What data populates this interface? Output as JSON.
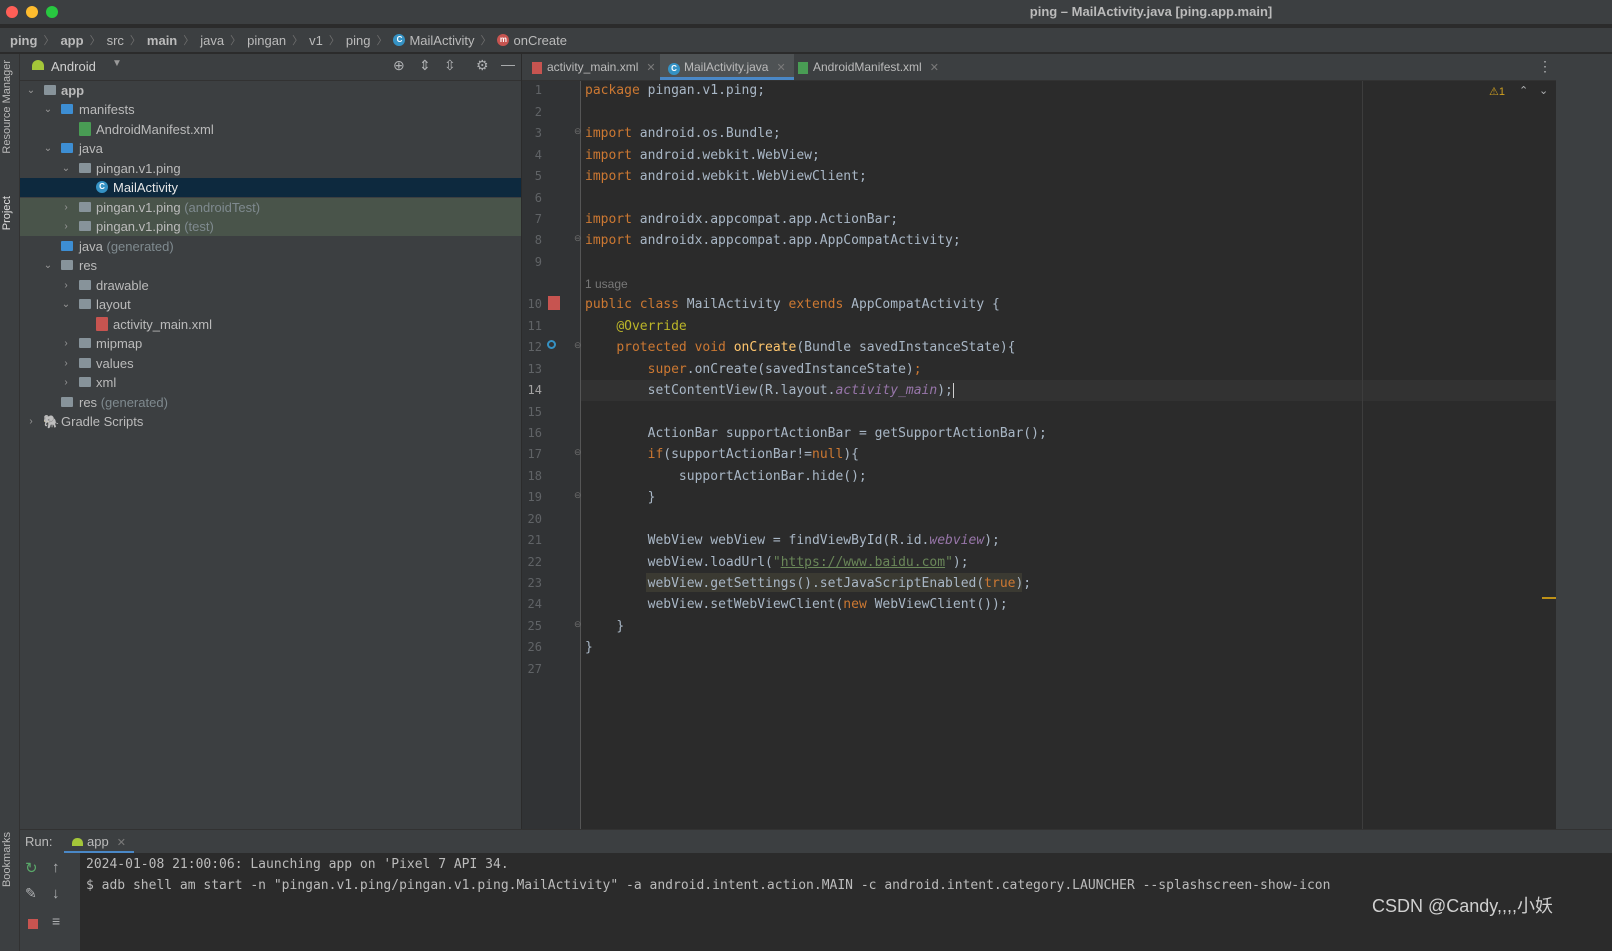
{
  "window": {
    "title": "ping – MailActivity.java [ping.app.main]"
  },
  "breadcrumb": {
    "items": [
      "ping",
      "app",
      "src",
      "main",
      "java",
      "pingan",
      "v1",
      "ping",
      "MailActivity",
      "onCreate"
    ]
  },
  "left_stripe": {
    "resource_manager": "Resource Manager",
    "project": "Project",
    "bookmarks": "Bookmarks"
  },
  "project_panel": {
    "view_selector": "Android",
    "tree": [
      {
        "label": "app",
        "suffix": ""
      },
      {
        "label": "manifests",
        "suffix": ""
      },
      {
        "label": "AndroidManifest.xml",
        "suffix": ""
      },
      {
        "label": "java",
        "suffix": ""
      },
      {
        "label": "pingan.v1.ping",
        "suffix": ""
      },
      {
        "label": "MailActivity",
        "suffix": ""
      },
      {
        "label": "pingan.v1.ping",
        "suffix": "(androidTest)"
      },
      {
        "label": "pingan.v1.ping",
        "suffix": "(test)"
      },
      {
        "label": "java",
        "suffix": "(generated)"
      },
      {
        "label": "res",
        "suffix": ""
      },
      {
        "label": "drawable",
        "suffix": ""
      },
      {
        "label": "layout",
        "suffix": ""
      },
      {
        "label": "activity_main.xml",
        "suffix": ""
      },
      {
        "label": "mipmap",
        "suffix": ""
      },
      {
        "label": "values",
        "suffix": ""
      },
      {
        "label": "xml",
        "suffix": ""
      },
      {
        "label": "res",
        "suffix": "(generated)"
      },
      {
        "label": "Gradle Scripts",
        "suffix": ""
      }
    ]
  },
  "editor": {
    "tabs": [
      "activity_main.xml",
      "MailActivity.java",
      "AndroidManifest.xml"
    ],
    "active_tab": "MailActivity.java",
    "warning_count": "1",
    "usage_hint": "1 usage",
    "line_numbers": [
      "1",
      "2",
      "3",
      "4",
      "5",
      "6",
      "7",
      "8",
      "9",
      "10",
      "11",
      "12",
      "13",
      "14",
      "15",
      "16",
      "17",
      "18",
      "19",
      "20",
      "21",
      "22",
      "23",
      "24",
      "25",
      "26",
      "27"
    ],
    "code": {
      "l1_kw": "package",
      "l1_rest": " pingan.v1.ping;",
      "l3_kw": "import",
      "l3_rest": " android.os.Bundle;",
      "l4_kw": "import",
      "l4_rest": " android.webkit.WebView;",
      "l5_kw": "import",
      "l5_rest": " android.webkit.WebViewClient;",
      "l7_kw": "import",
      "l7_rest": " androidx.appcompat.app.ActionBar;",
      "l8_kw": "import",
      "l8_rest": " androidx.appcompat.app.AppCompatActivity;",
      "l10_kw1": "public class",
      "l10_name": " MailActivity ",
      "l10_kw2": "extends",
      "l10_rest": " AppCompatActivity {",
      "l11_ann": "@Override",
      "l12_kw": "protected void",
      "l12_fn": " onCreate",
      "l12_rest": "(Bundle savedInstanceState){",
      "l13_kw": "super",
      "l13_rest": ".onCreate(savedInstanceState)",
      "l13_semi": ";",
      "l14_a": "setContentView(R.layout.",
      "l14_it": "activity_main",
      "l14_b": ");",
      "l16": "ActionBar supportActionBar = getSupportActionBar();",
      "l17_kw": "if",
      "l17_a": "(supportActionBar!=",
      "l17_kw2": "null",
      "l17_b": "){",
      "l18": "supportActionBar.hide();",
      "l19": "}",
      "l21_a": "WebView webView = findViewById(R.id.",
      "l21_it": "webview",
      "l21_b": ");",
      "l22_a": "webView.loadUrl(",
      "l22_q1": "\"",
      "l22_url": "https://www.baidu.com",
      "l22_q2": "\"",
      "l22_b": ");",
      "l23_a": "webView.getSettings().setJavaScriptEnabled(",
      "l23_kw": "true",
      "l23_b": ");",
      "l24_a": "webView.setWebViewClient(",
      "l24_kw": "new",
      "l24_b": " WebViewClient());",
      "l25": "}",
      "l26": "}"
    }
  },
  "run_panel": {
    "label": "Run:",
    "tab": "app",
    "lines": [
      "2024-01-08 21:00:06: Launching app on 'Pixel 7 API 34.",
      "$ adb shell am start -n \"pingan.v1.ping/pingan.v1.ping.MailActivity\" -a android.intent.action.MAIN -c android.intent.category.LAUNCHER --splashscreen-show-icon"
    ]
  },
  "watermark": "CSDN @Candy,,,,小妖",
  "colors": {
    "keyword": "#cc7832",
    "annotation": "#bbb529",
    "function": "#ffc66d",
    "field": "#9876aa",
    "string": "#6a8759",
    "accent": "#4a88c7"
  }
}
